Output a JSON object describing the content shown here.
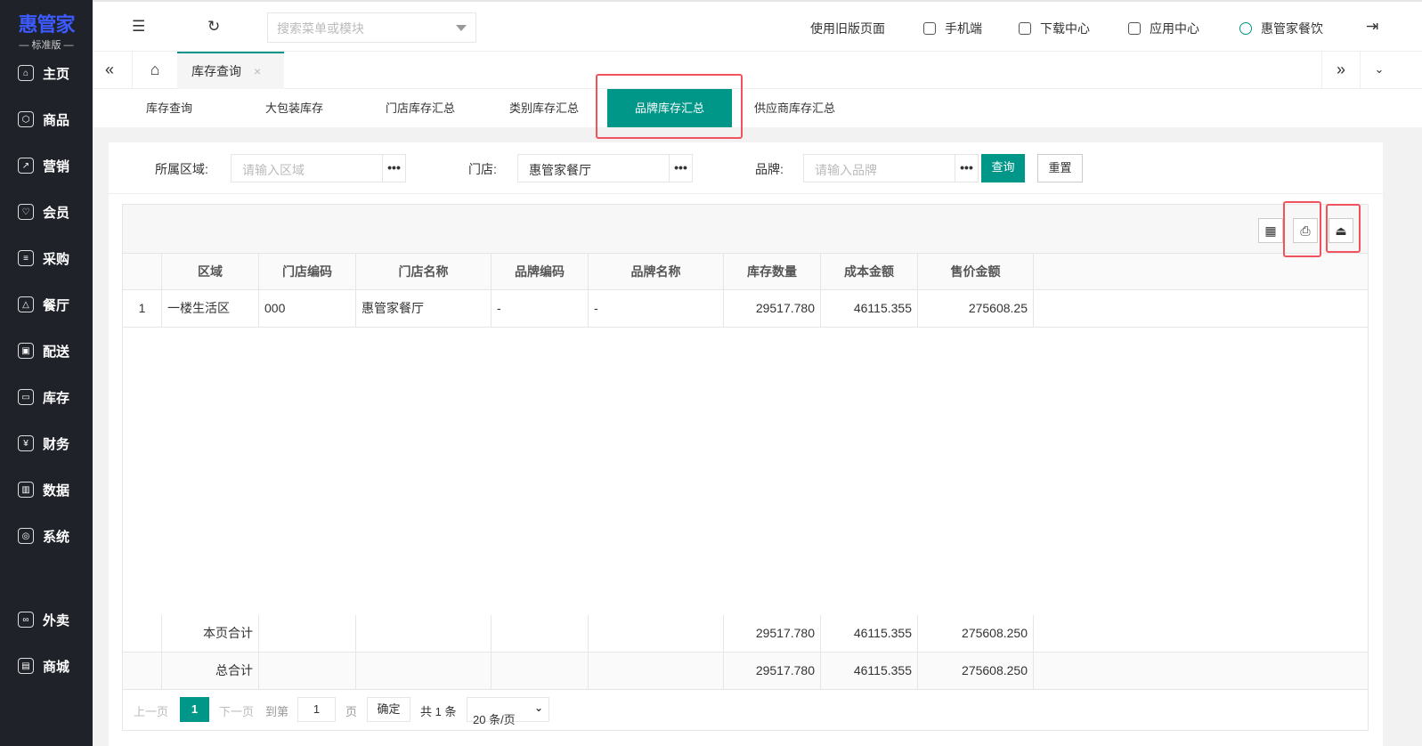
{
  "sidebar": {
    "logo": "惠管家",
    "edition": "— 标准版 —",
    "items": [
      {
        "label": "主页",
        "icon": "⌂"
      },
      {
        "label": "商品",
        "icon": "⬡"
      },
      {
        "label": "营销",
        "icon": "↗"
      },
      {
        "label": "会员",
        "icon": "♡"
      },
      {
        "label": "采购",
        "icon": "≡"
      },
      {
        "label": "餐厅",
        "icon": "△"
      },
      {
        "label": "配送",
        "icon": "▣"
      },
      {
        "label": "库存",
        "icon": "▭"
      },
      {
        "label": "财务",
        "icon": "¥"
      },
      {
        "label": "数据",
        "icon": "▥"
      },
      {
        "label": "系统",
        "icon": "◎"
      }
    ],
    "extra": [
      {
        "label": "外卖",
        "icon": "∞"
      },
      {
        "label": "商城",
        "icon": "▤"
      }
    ]
  },
  "header": {
    "search_placeholder": "搜索菜单或模块",
    "links": [
      "使用旧版页面",
      "手机端",
      "下载中心",
      "应用中心",
      "惠管家餐饮"
    ]
  },
  "tabs": {
    "open": "库存查询",
    "close": "×"
  },
  "subtabs": [
    "库存查询",
    "大包装库存",
    "门店库存汇总",
    "类别库存汇总",
    "品牌库存汇总",
    "供应商库存汇总"
  ],
  "filters": {
    "area_label": "所属区域:",
    "area_placeholder": "请输入区域",
    "store_label": "门店:",
    "store_value": "惠管家餐厅",
    "brand_label": "品牌:",
    "brand_placeholder": "请输入品牌",
    "query": "查询",
    "reset": "重置",
    "dots": "•••"
  },
  "table": {
    "columns": [
      "区域",
      "门店编码",
      "门店名称",
      "品牌编码",
      "品牌名称",
      "库存数量",
      "成本金额",
      "售价金额"
    ],
    "rows": [
      {
        "idx": "1",
        "area": "一楼生活区",
        "code": "000",
        "store": "惠管家餐厅",
        "bcode": "-",
        "bname": "-",
        "qty": "29517.780",
        "cost": "46115.355",
        "price": "275608.25"
      }
    ],
    "page_total": {
      "label": "本页合计",
      "qty": "29517.780",
      "cost": "46115.355",
      "price": "275608.250"
    },
    "grand_total": {
      "label": "总合计",
      "qty": "29517.780",
      "cost": "46115.355",
      "price": "275608.250"
    }
  },
  "pager": {
    "prev": "上一页",
    "current": "1",
    "next": "下一页",
    "goto": "到第",
    "page_input": "1",
    "page_unit": "页",
    "confirm": "确定",
    "total": "共 1 条",
    "page_size": "20 条/页"
  }
}
